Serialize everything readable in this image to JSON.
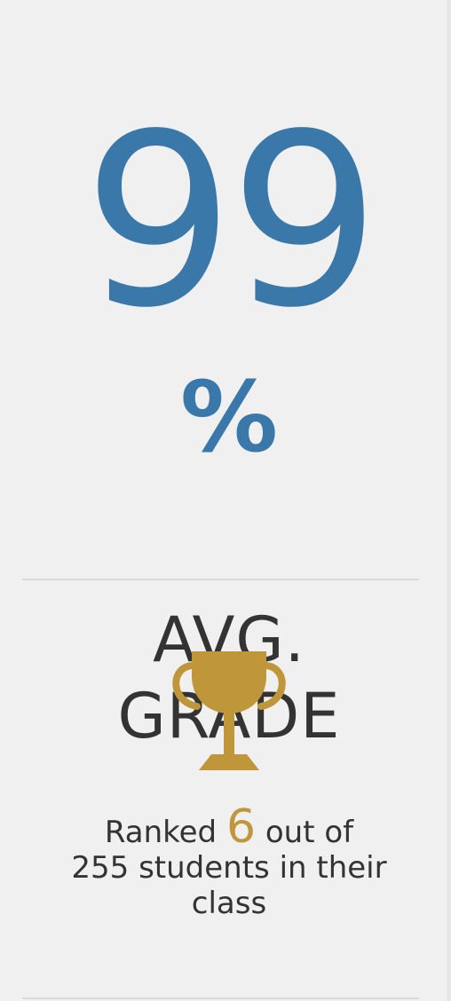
{
  "stat": {
    "value": "99",
    "unit": "%",
    "label_line1": "AVG.",
    "label_line2": "GRADE",
    "trophy_color": "#bf963a",
    "value_color": "#3a78a9"
  },
  "rank": {
    "prefix": "Ranked",
    "position": "6",
    "middle": "out of",
    "total_text": "255 students in their class"
  },
  "icons": {
    "trophy": "trophy-icon"
  }
}
